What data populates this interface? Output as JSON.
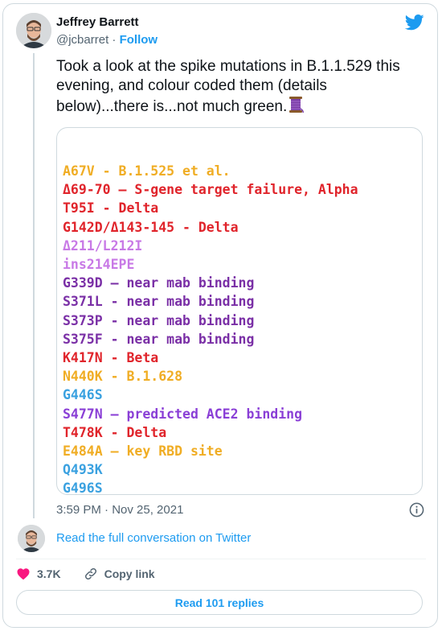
{
  "author": {
    "name": "Jeffrey Barrett",
    "handle": "@jcbarret",
    "separator": "·",
    "follow_label": "Follow"
  },
  "tweet": {
    "text": "Took a look at the spike mutations in B.1.1.529 this evening, and colour coded them (details below)...there is...not much green."
  },
  "mutations": [
    {
      "text": "A67V - B.1.525 et al.",
      "color": "#f0ad24"
    },
    {
      "text": "Δ69-70 — S-gene target failure, Alpha",
      "color": "#e0242b"
    },
    {
      "text": "T95I - Delta",
      "color": "#e0242b"
    },
    {
      "text": "G142D/Δ143-145 - Delta",
      "color": "#e0242b"
    },
    {
      "text": "Δ211/L212I",
      "color": "#c879e6"
    },
    {
      "text": "ins214EPE",
      "color": "#c879e6"
    },
    {
      "text": "G339D — near mab binding",
      "color": "#7a2fa6"
    },
    {
      "text": "S371L - near mab binding",
      "color": "#7a2fa6"
    },
    {
      "text": "S373P - near mab binding",
      "color": "#7a2fa6"
    },
    {
      "text": "S375F - near mab binding",
      "color": "#7a2fa6"
    },
    {
      "text": "K417N - Beta",
      "color": "#e0242b"
    },
    {
      "text": "N440K - B.1.628",
      "color": "#f0ad24"
    },
    {
      "text": "G446S",
      "color": "#3aa1e0"
    },
    {
      "text": "S477N — predicted ACE2 binding",
      "color": "#8a3fd6"
    },
    {
      "text": "T478K - Delta",
      "color": "#e0242b"
    },
    {
      "text": "E484A — key RBD site",
      "color": "#f0ad24"
    },
    {
      "text": "Q493K",
      "color": "#3aa1e0"
    },
    {
      "text": "G496S",
      "color": "#3aa1e0"
    }
  ],
  "timestamp": "3:59 PM · Nov 25, 2021",
  "read_conversation": "Read the full conversation on Twitter",
  "actions": {
    "likes": "3.7K",
    "copy_link": "Copy link"
  },
  "replies_button": "Read 101 replies",
  "colors": {
    "accent": "#1d9bf0",
    "heart": "#f91880"
  },
  "icons": [
    "twitter-bird-icon",
    "spool-of-thread-icon",
    "info-icon",
    "heart-icon",
    "link-icon"
  ]
}
